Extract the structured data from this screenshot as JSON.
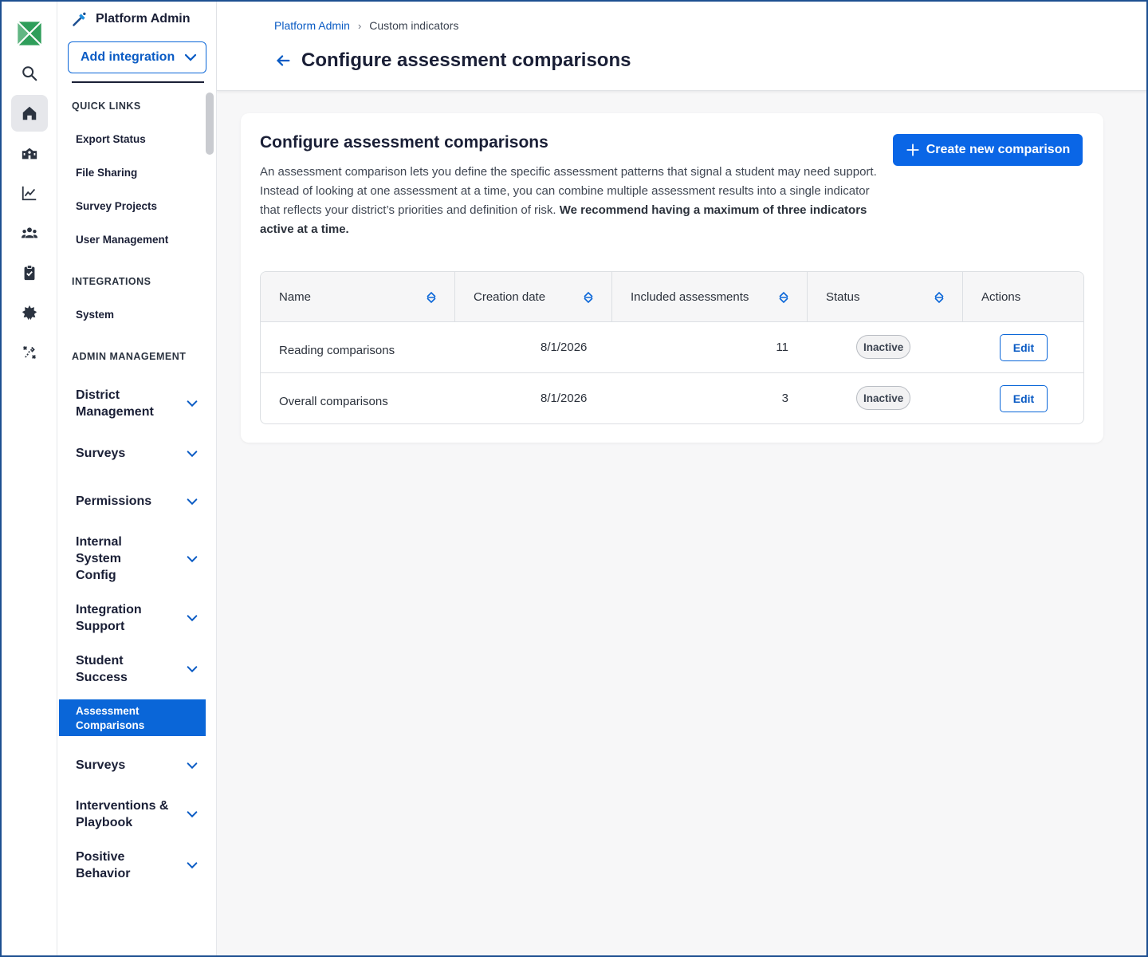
{
  "app": {
    "rail_icons": [
      "app-logo-icon",
      "search-icon",
      "home-icon",
      "school-icon",
      "chart-icon",
      "people-icon",
      "clipboard-icon",
      "badge-icon",
      "strategy-icon"
    ]
  },
  "sidebar": {
    "title": "Platform Admin",
    "add_integration_label": "Add integration",
    "quick_links_heading": "QUICK LINKS",
    "quick_links": [
      "Export Status",
      "File Sharing",
      "Survey Projects",
      "User Management"
    ],
    "integrations_heading": "INTEGRATIONS",
    "integrations": [
      "System"
    ],
    "admin_heading": "ADMIN MANAGEMENT",
    "groups": [
      "District Management",
      "Surveys",
      "Permissions",
      "Internal System Config",
      "Integration Support",
      "Student Success"
    ],
    "active_item": "Assessment Comparisons",
    "groups_after": [
      "Surveys",
      "Interventions & Playbook",
      "Positive Behavior"
    ]
  },
  "header": {
    "breadcrumb_root": "Platform Admin",
    "breadcrumb_current": "Custom indicators",
    "title": "Configure assessment comparisons"
  },
  "card": {
    "title": "Configure assessment comparisons",
    "description": "An assessment comparison lets you define the specific assessment patterns that signal a student may need support. Instead of looking at one assessment at a time, you can combine multiple assessment results into a single indicator that reflects your district’s priorities and definition of risk.",
    "recommendation": "We recommend having a maximum of three indicators active at a time.",
    "create_button": "Create new comparison"
  },
  "table": {
    "columns": [
      "Name",
      "Creation date",
      "Included assessments",
      "Status",
      "Actions"
    ],
    "rows": [
      {
        "name": "Reading comparisons",
        "date": "8/1/2026",
        "count": "11",
        "status": "Inactive",
        "action": "Edit"
      },
      {
        "name": "Overall comparisons",
        "date": "8/1/2026",
        "count": "3",
        "status": "Inactive",
        "action": "Edit"
      }
    ]
  },
  "colors": {
    "accent": "#0a66d8",
    "brand_green": "#2e9e5a",
    "text_dark": "#1a1f36"
  }
}
